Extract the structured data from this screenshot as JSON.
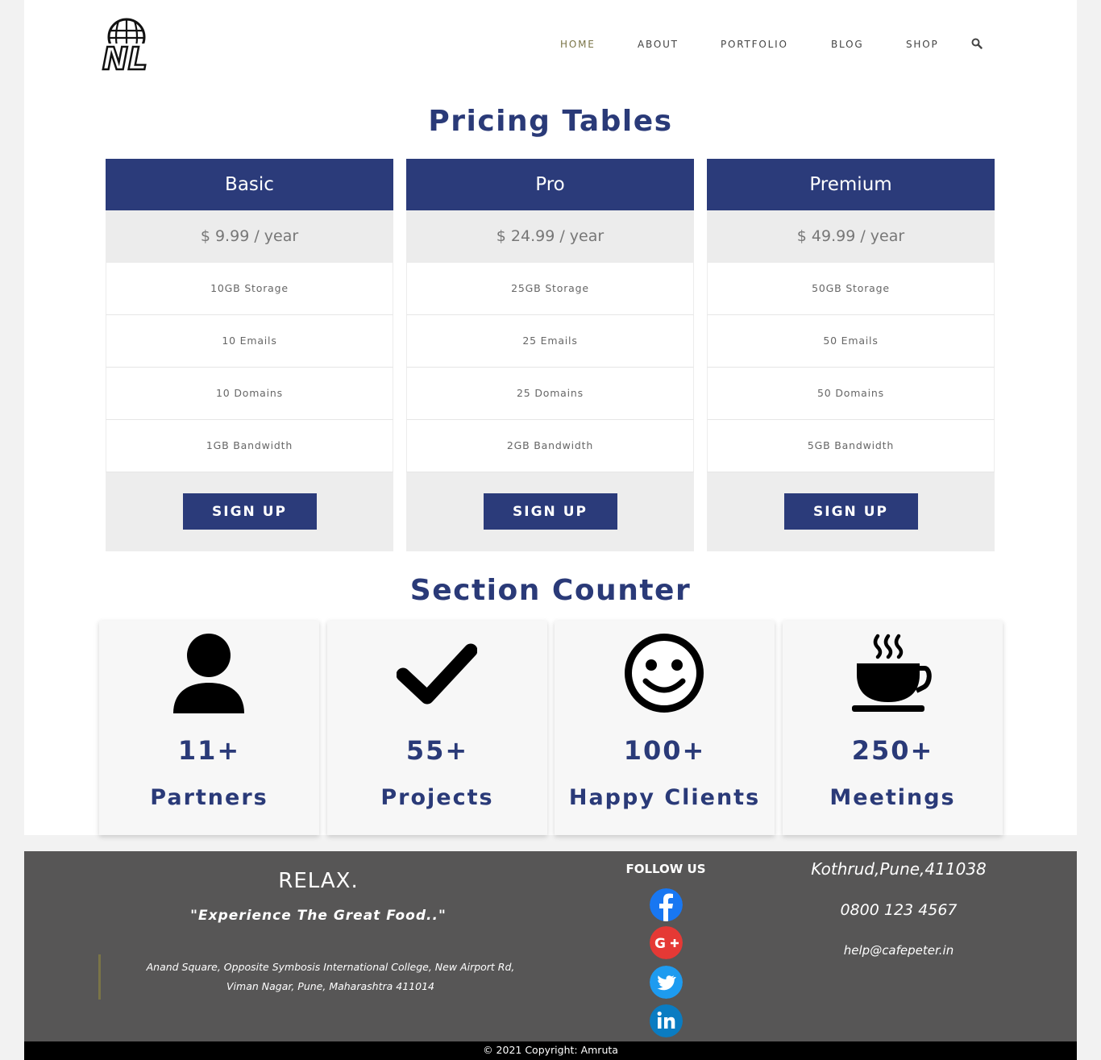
{
  "nav": {
    "items": [
      {
        "label": "HOME",
        "active": true
      },
      {
        "label": "ABOUT",
        "active": false
      },
      {
        "label": "PORTFOLIO",
        "active": false
      },
      {
        "label": "BLOG",
        "active": false
      },
      {
        "label": "SHOP",
        "active": false
      }
    ],
    "search_icon": "search-icon",
    "logo_text": "NL"
  },
  "pricing": {
    "title": "Pricing Tables",
    "plans": [
      {
        "name": "Basic",
        "price": "$ 9.99 / year",
        "features": [
          "10GB Storage",
          "10 Emails",
          "10 Domains",
          "1GB Bandwidth"
        ],
        "cta": "SIGN UP"
      },
      {
        "name": "Pro",
        "price": "$ 24.99 / year",
        "features": [
          "25GB Storage",
          "25 Emails",
          "25 Domains",
          "2GB Bandwidth"
        ],
        "cta": "SIGN UP"
      },
      {
        "name": "Premium",
        "price": "$ 49.99 / year",
        "features": [
          "50GB Storage",
          "50 Emails",
          "50 Domains",
          "5GB Bandwidth"
        ],
        "cta": "SIGN UP"
      }
    ]
  },
  "counters": {
    "title": "Section Counter",
    "items": [
      {
        "icon": "user-icon",
        "value": "11+",
        "label": "Partners"
      },
      {
        "icon": "check-icon",
        "value": "55+",
        "label": "Projects"
      },
      {
        "icon": "smile-icon",
        "value": "100+",
        "label": "Happy Clients"
      },
      {
        "icon": "coffee-icon",
        "value": "250+",
        "label": "Meetings"
      }
    ]
  },
  "footer": {
    "heading": "RELAX.",
    "tagline": "\"Experience The Great Food..\"",
    "address_line1": "Anand Square, Opposite Symbosis International College, New Airport Rd,",
    "address_line2": "Viman Nagar, Pune, Maharashtra 411014",
    "follow_label": "FOLLOW US",
    "social": [
      {
        "icon": "facebook-icon",
        "color": "#1877f2"
      },
      {
        "icon": "google-plus-icon",
        "color": "#e53935"
      },
      {
        "icon": "twitter-icon",
        "color": "#1d9bf0"
      },
      {
        "icon": "linkedin-icon",
        "color": "#0a7cc2"
      }
    ],
    "location": "Kothrud,Pune,411038",
    "phone": "0800 123 4567",
    "email": "help@cafepeter.in",
    "copyright": "© 2021 Copyright: Amruta"
  },
  "colors": {
    "primary": "#2b3b7a",
    "nav_active": "#7a7447",
    "footer_bg": "#575656"
  }
}
